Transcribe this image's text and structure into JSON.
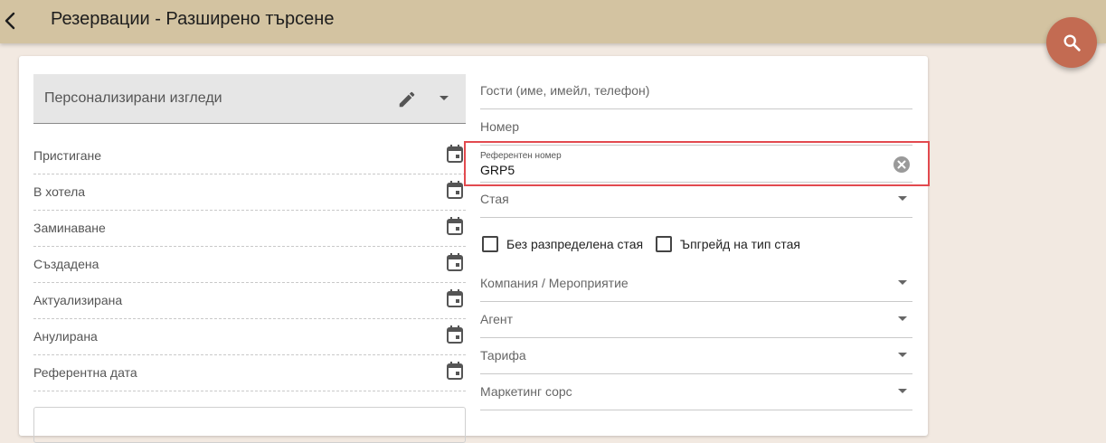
{
  "header": {
    "title": "Резервации - Разширено търсене"
  },
  "views": {
    "label": "Персонализирани изгледи"
  },
  "date_filters": [
    {
      "label": "Пристигане"
    },
    {
      "label": "В хотела"
    },
    {
      "label": "Заминаване"
    },
    {
      "label": "Създадена"
    },
    {
      "label": "Актуализирана"
    },
    {
      "label": "Анулирана"
    },
    {
      "label": "Референтна дата"
    }
  ],
  "fields": {
    "guests": {
      "label": "Гости (име, имейл, телефон)"
    },
    "number": {
      "label": "Номер"
    },
    "reference": {
      "label": "Референтен номер",
      "value": "GRP5"
    },
    "room": {
      "label": "Стая"
    },
    "company": {
      "label": "Компания / Мероприятие"
    },
    "agent": {
      "label": "Агент"
    },
    "rate": {
      "label": "Тарифа"
    },
    "marketing": {
      "label": "Маркетинг сорс"
    }
  },
  "checkboxes": {
    "unassigned_room": {
      "label": "Без разпределена стая",
      "checked": false
    },
    "upgrade_room_type": {
      "label": "Ъпгрейд на тип стая",
      "checked": false
    }
  },
  "colors": {
    "topbar": "#d3c3a1",
    "fab": "#c36b52",
    "highlight": "#e24a4f",
    "background": "#f2e9e1"
  }
}
